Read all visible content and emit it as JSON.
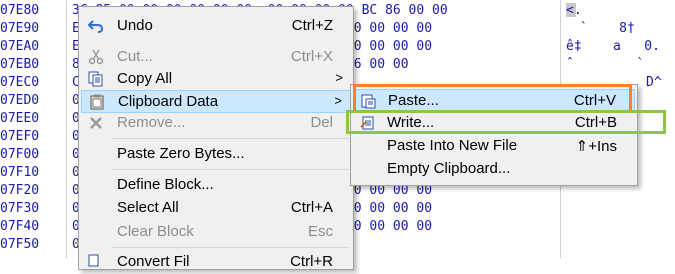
{
  "hex_view": {
    "offsets": [
      "07E80",
      "07E90",
      "07EA0",
      "07EB0",
      "07EC0",
      "07ED0",
      "07EE0",
      "07EF0",
      "07F00",
      "07F10",
      "07F20",
      "07F30",
      "07F40",
      "07F50"
    ],
    "row0_hex": "3C 85 00 00 00 00 00 00  00 00 00 00 BC 86 00 00",
    "row1_hex": "E                      00 00 00 00 00 00 00 00",
    "row2_hex": "E                      85 00 00 00 00 00 00 00",
    "row3_hex": "8                      50 00 00 2C 86 00 00",
    "row4_hex": "C",
    "row5_hex": "0",
    "row6_hex": "0",
    "row7_hex": "0",
    "row8_hex": "0",
    "row9_hex": "0",
    "row10_hex": "0                      00 00 00 00 00 00 00 00",
    "row11_hex": "0                      00 00 00 00 00 00 00 00",
    "row12_hex": "0                      00 00 00 00 00 00 00 00",
    "row13_hex": "0",
    "ascii0": "<.",
    "ascii1": "`    8†",
    "ascii2": "ê‡    a   0.",
    "ascii3": "ˆ        `",
    "ascii4": "D^"
  },
  "main_menu": {
    "undo": {
      "label": "Undo",
      "shortcut": "Ctrl+Z"
    },
    "cut": {
      "label": "Cut...",
      "shortcut": "Ctrl+X"
    },
    "copy_all": {
      "label": "Copy All"
    },
    "clipboard_data": {
      "label": "Clipboard Data"
    },
    "remove": {
      "label": "Remove...",
      "shortcut": "Del"
    },
    "paste_zero": {
      "label": "Paste Zero Bytes..."
    },
    "define_block": {
      "label": "Define Block..."
    },
    "select_all": {
      "label": "Select All",
      "shortcut": "Ctrl+A"
    },
    "clear_block": {
      "label": "Clear Block",
      "shortcut": "Esc"
    },
    "convert_file": {
      "label": "Convert Fil",
      "shortcut": "Ctrl+R"
    }
  },
  "sub_menu": {
    "paste": {
      "label": "Paste...",
      "shortcut": "Ctrl+V"
    },
    "write": {
      "label": "Write...",
      "shortcut": "Ctrl+B"
    },
    "paste_new_file": {
      "label": "Paste Into New File",
      "shortcut": "⇑+Ins"
    },
    "empty_clipboard": {
      "label": "Empty Clipboard..."
    }
  },
  "arrow_glyph": ">",
  "colors": {
    "highlight": "#cce8ff",
    "hex_text": "#1a1aa6",
    "orange_annotation": "#ff7f27",
    "green_annotation": "#8dc63f"
  }
}
